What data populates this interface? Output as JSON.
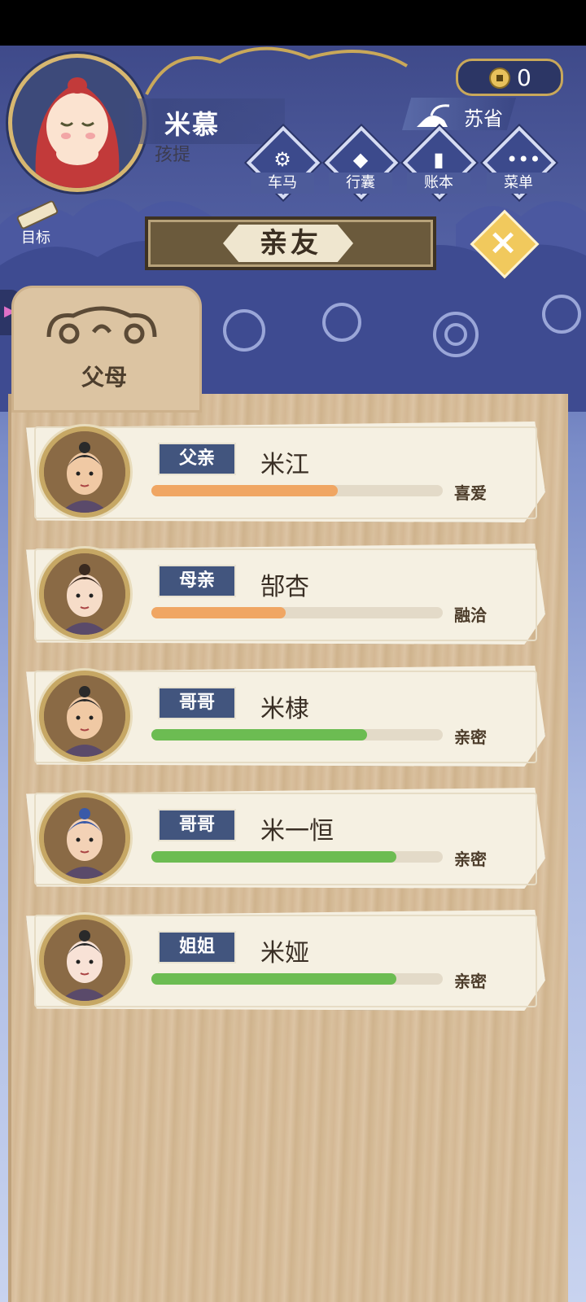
{
  "player": {
    "name": "米慕",
    "title": "孩提"
  },
  "currency": {
    "coins": "0"
  },
  "location": {
    "name": "苏省"
  },
  "menu": [
    {
      "label": "车马",
      "icon": "carriage-icon"
    },
    {
      "label": "行囊",
      "icon": "bag-icon"
    },
    {
      "label": "账本",
      "icon": "ledger-icon"
    },
    {
      "label": "菜单",
      "icon": "more-icon"
    }
  ],
  "goal": {
    "label": "目标"
  },
  "page": {
    "title": "亲友",
    "close_icon": "close-icon"
  },
  "tab": {
    "label": "父母"
  },
  "members": [
    {
      "relation": "父亲",
      "name": "米江",
      "status": "喜爱",
      "level": 0.64,
      "color": "#f0a663"
    },
    {
      "relation": "母亲",
      "name": "郜杏",
      "status": "融洽",
      "level": 0.46,
      "color": "#f0a663"
    },
    {
      "relation": "哥哥",
      "name": "米棣",
      "status": "亲密",
      "level": 0.74,
      "color": "#6cbc52"
    },
    {
      "relation": "哥哥",
      "name": "米一恒",
      "status": "亲密",
      "level": 0.84,
      "color": "#6cbc52"
    },
    {
      "relation": "姐姐",
      "name": "米娅",
      "status": "亲密",
      "level": 0.84,
      "color": "#6cbc52"
    }
  ]
}
